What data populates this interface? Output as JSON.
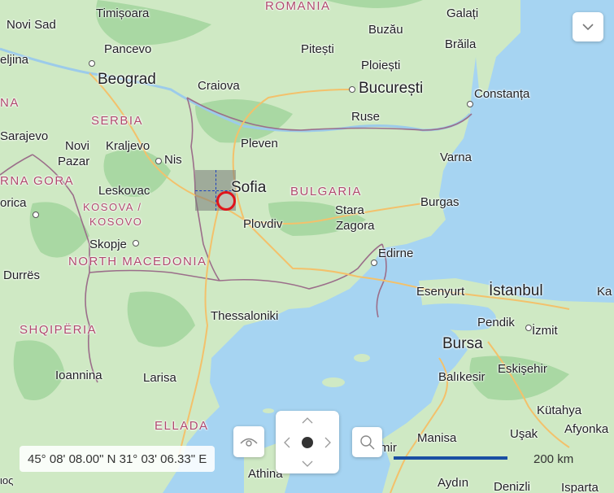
{
  "map": {
    "countries": {
      "romania": "ROMANIA",
      "serbia": "SERBIA",
      "bulgaria": "BULGARIA",
      "kosovo_line1": "KOSOVA /",
      "kosovo_line2": "KOSOVO",
      "crna_gora": "RNA GORA",
      "north_macedonia": "NORTH MACEDONIA",
      "shqiperia": "SHQIPËRIA",
      "ellada": "ELLADA",
      "bih_part": "NA"
    },
    "cities": {
      "timisoara": "Timișoara",
      "novi_sad": "Novi Sad",
      "pancevo": "Pancevo",
      "beograd": "Beograd",
      "eljina": "eljina",
      "craiova": "Craiova",
      "pitesti": "Pitești",
      "ploiesti": "Ploiești",
      "bucuresti": "București",
      "buzau": "Buzău",
      "galati": "Galați",
      "braila": "Brăila",
      "constanta": "Constanța",
      "ruse": "Ruse",
      "sarajevo": "Sarajevo",
      "novi_pazar_1": "Novi",
      "novi_pazar_2": "Pazar",
      "kraljevo": "Kraljevo",
      "nis": "Nis",
      "pleven": "Pleven",
      "varna": "Varna",
      "sofia": "Sofia",
      "leskovac": "Leskovac",
      "orica": "orica",
      "burgas": "Burgas",
      "stara_zagora_1": "Stara",
      "stara_zagora_2": "Zagora",
      "plovdiv": "Plovdiv",
      "skopje": "Skopje",
      "edirne": "Edirne",
      "durres": "Durrës",
      "esenyurt": "Esenyurt",
      "istanbul": "İstanbul",
      "ka": "Ka",
      "thessaloniki": "Thessaloniki",
      "pendik": "Pendik",
      "izmit": "İzmit",
      "bursa": "Bursa",
      "ioannina": "Ioannina",
      "larisa": "Larisa",
      "balikesir": "Balıkesir",
      "eskisehir": "Eskişehir",
      "kutahya": "Kütahya",
      "usak": "Uşak",
      "afyonka": "Afyonka",
      "manisa": "Manisa",
      "izmir_part": "mir",
      "athina": "Athina",
      "aydin": "Aydın",
      "denizli": "Denizli",
      "isparta": "Isparta",
      "yos": "ιος"
    }
  },
  "controls": {
    "coordinates": "45° 08' 08.00\" N  31° 03' 06.33\" E",
    "scale_label": "200 km",
    "menu_icon": "chevron-down-icon",
    "eye_icon": "eye-icon",
    "search_icon": "search-icon"
  },
  "colors": {
    "land": "#cfe9c4",
    "forest": "#a9d8a3",
    "sea": "#a6d4f2",
    "road": "#f3c16b",
    "border": "#9b6e8a",
    "marker": "#e0131b",
    "scale_bar": "#1a4fa3"
  }
}
